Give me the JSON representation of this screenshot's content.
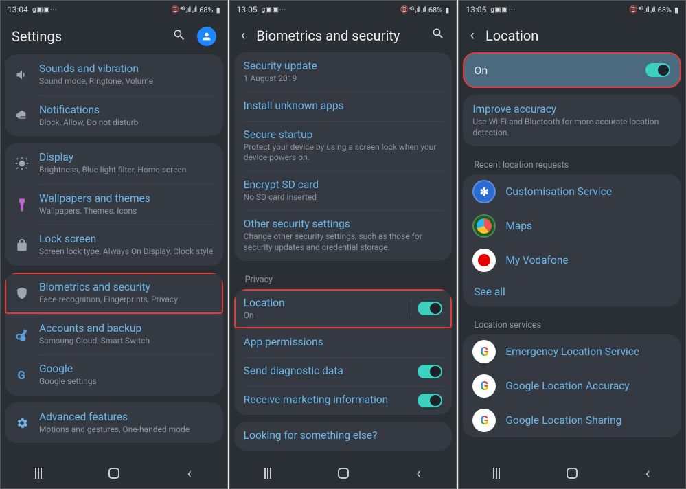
{
  "status": {
    "battery": "68%",
    "times": [
      "13:04",
      "13:05",
      "13:05"
    ]
  },
  "s1": {
    "title": "Settings",
    "groups": [
      [
        {
          "icon": "volume",
          "t": "Sounds and vibration",
          "s": "Sound mode, Ringtone, Volume"
        },
        {
          "icon": "notif",
          "t": "Notifications",
          "s": "Block, Allow, Do not disturb"
        }
      ],
      [
        {
          "icon": "sun",
          "t": "Display",
          "s": "Brightness, Blue light filter, Home screen"
        },
        {
          "icon": "brush",
          "t": "Wallpapers and themes",
          "s": "Wallpapers, Themes, Icons"
        },
        {
          "icon": "lock",
          "t": "Lock screen",
          "s": "Screen lock type, Always On Display, Clock style"
        }
      ],
      [
        {
          "icon": "shield",
          "t": "Biometrics and security",
          "s": "Face recognition, Fingerprints, Privacy",
          "hl": true
        },
        {
          "icon": "key",
          "t": "Accounts and backup",
          "s": "Samsung Cloud, Smart Switch"
        },
        {
          "icon": "google",
          "t": "Google",
          "s": "Google settings"
        }
      ],
      [
        {
          "icon": "gear",
          "t": "Advanced features",
          "s": "Motions and gestures, One-handed mode"
        }
      ]
    ]
  },
  "s2": {
    "title": "Biometrics and security",
    "group1": [
      {
        "t": "Security update",
        "s": "1 August 2019"
      },
      {
        "t": "Install unknown apps"
      },
      {
        "t": "Secure startup",
        "s": "Protect your device by using a screen lock when your device powers on."
      },
      {
        "t": "Encrypt SD card",
        "s": "No SD card inserted"
      },
      {
        "t": "Other security settings",
        "s": "Change other security settings, such as those for security updates and credential storage."
      }
    ],
    "privacy_label": "Privacy",
    "group2": [
      {
        "t": "Location",
        "s": "On",
        "toggle": true,
        "sep": true,
        "hl": true
      },
      {
        "t": "App permissions"
      },
      {
        "t": "Send diagnostic data",
        "toggle": true
      },
      {
        "t": "Receive marketing information",
        "toggle": true
      }
    ],
    "footer": "Looking for something else?"
  },
  "s3": {
    "title": "Location",
    "on_label": "On",
    "improve": {
      "t": "Improve accuracy",
      "s": "Use Wi-Fi and Bluetooth for more accurate location detection."
    },
    "recent_label": "Recent location requests",
    "recent": [
      {
        "icon": "cust",
        "t": "Customisation Service"
      },
      {
        "icon": "maps",
        "t": "Maps"
      },
      {
        "icon": "voda",
        "t": "My Vodafone"
      }
    ],
    "see_all": "See all",
    "services_label": "Location services",
    "services": [
      {
        "icon": "g",
        "t": "Emergency Location Service"
      },
      {
        "icon": "g",
        "t": "Google Location Accuracy"
      },
      {
        "icon": "g",
        "t": "Google Location Sharing"
      }
    ]
  }
}
